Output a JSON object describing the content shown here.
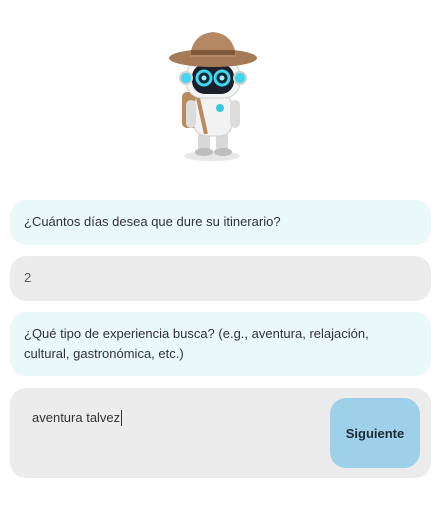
{
  "mascot": {
    "icon": "robot-explorer-icon"
  },
  "chat": {
    "messages": [
      {
        "role": "bot",
        "text": "¿Cuántos días desea que dure su itinerario?"
      },
      {
        "role": "user",
        "text": "2"
      },
      {
        "role": "bot",
        "text": "¿Qué tipo de experiencia busca? (e.g., aventura, relajación, cultural, gastronómica, etc.)"
      }
    ]
  },
  "composer": {
    "value": "aventura talvez",
    "button_label": "Siguiente"
  },
  "colors": {
    "bot_bubble": "#e9f8f8",
    "user_bubble": "#ececec",
    "button": "#9fd0ea"
  }
}
